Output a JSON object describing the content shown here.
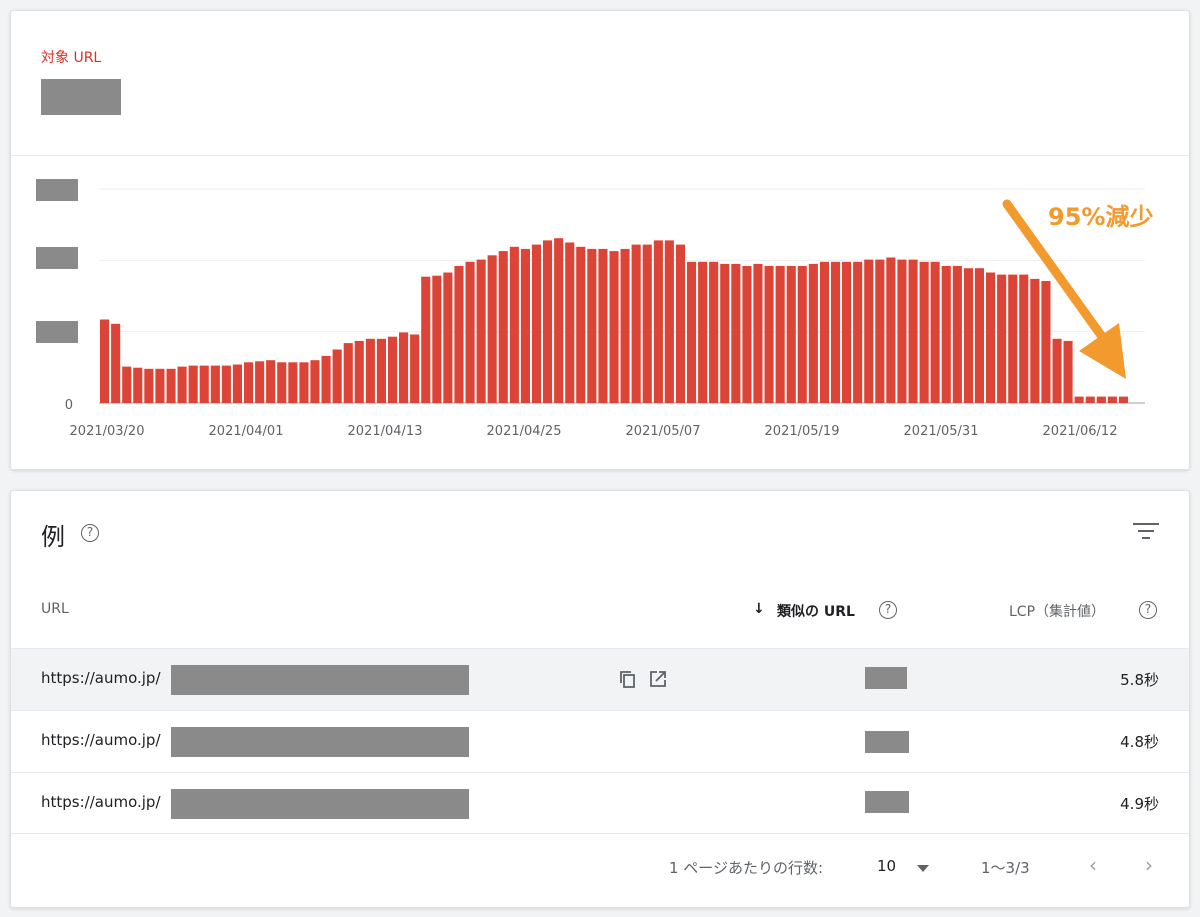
{
  "chart_card": {
    "target_label": "対象 URL",
    "annotation": "95%減少"
  },
  "chart_data": {
    "type": "bar",
    "bar_color": "#db4437",
    "annotation_color": "#f29a2e",
    "ylabel_zero": "0",
    "tick_labels": [
      "2021/03/20",
      "2021/04/01",
      "2021/04/13",
      "2021/04/25",
      "2021/05/07",
      "2021/05/19",
      "2021/05/31",
      "2021/06/12"
    ],
    "values_relative": [
      0.39,
      0.37,
      0.17,
      0.165,
      0.16,
      0.16,
      0.16,
      0.17,
      0.175,
      0.175,
      0.175,
      0.175,
      0.18,
      0.19,
      0.195,
      0.2,
      0.19,
      0.19,
      0.19,
      0.2,
      0.22,
      0.25,
      0.28,
      0.29,
      0.3,
      0.3,
      0.31,
      0.33,
      0.32,
      0.59,
      0.595,
      0.61,
      0.64,
      0.66,
      0.67,
      0.69,
      0.71,
      0.73,
      0.72,
      0.74,
      0.76,
      0.77,
      0.75,
      0.73,
      0.72,
      0.72,
      0.71,
      0.72,
      0.74,
      0.74,
      0.76,
      0.76,
      0.74,
      0.66,
      0.66,
      0.66,
      0.65,
      0.65,
      0.64,
      0.65,
      0.64,
      0.64,
      0.64,
      0.64,
      0.65,
      0.66,
      0.66,
      0.66,
      0.66,
      0.67,
      0.67,
      0.68,
      0.67,
      0.67,
      0.66,
      0.66,
      0.64,
      0.64,
      0.63,
      0.63,
      0.61,
      0.6,
      0.6,
      0.6,
      0.58,
      0.57,
      0.3,
      0.29,
      0.03,
      0.03,
      0.03,
      0.03,
      0.03
    ]
  },
  "table": {
    "title": "例",
    "help_glyph": "?",
    "columns": {
      "url": "URL",
      "similar": "類似の URL",
      "lcp": "LCP（集計値）",
      "sort_arrow": "↓"
    },
    "rows": [
      {
        "url": "https://aumo.jp/",
        "lcp": "5.8秒"
      },
      {
        "url": "https://aumo.jp/",
        "lcp": "4.8秒"
      },
      {
        "url": "https://aumo.jp/",
        "lcp": "4.9秒"
      }
    ],
    "footer": {
      "rows_per_page_label": "1 ページあたりの行数:",
      "rows_per_page": "10",
      "range": "1〜3/3",
      "prev": "‹",
      "next": "›"
    }
  }
}
